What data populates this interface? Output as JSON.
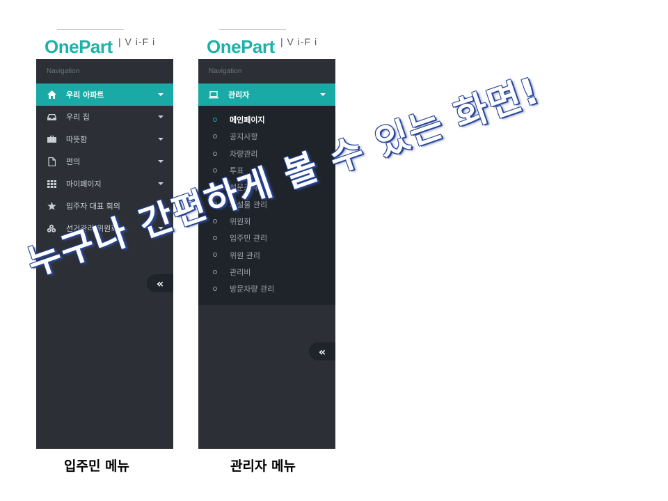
{
  "left_panel": {
    "logo": {
      "text": "OnePart",
      "sub": "| V i-F i"
    },
    "nav_header": "Navigation",
    "items": [
      {
        "label": "우리 아파트",
        "icon": "home-icon",
        "active": true
      },
      {
        "label": "우리 집",
        "icon": "inbox-icon",
        "active": false
      },
      {
        "label": "따뜻함",
        "icon": "briefcase-icon",
        "active": false
      },
      {
        "label": "편의",
        "icon": "file-icon",
        "active": false
      },
      {
        "label": "마이페이지",
        "icon": "grid-icon",
        "active": false
      },
      {
        "label": "입주자 대표 회의",
        "icon": "star-icon",
        "active": false
      },
      {
        "label": "선거관리 위원회",
        "icon": "cubes-icon",
        "active": false
      }
    ],
    "collapse_label": "«",
    "caption": "입주민 메뉴"
  },
  "right_panel": {
    "logo": {
      "text": "OnePart",
      "sub": "| V i-F i"
    },
    "nav_header": "Navigation",
    "active_item": {
      "label": "관리자",
      "icon": "laptop-icon"
    },
    "submenu": [
      {
        "label": "메인페이지",
        "active": true
      },
      {
        "label": "공지사항",
        "active": false
      },
      {
        "label": "차량관리",
        "active": false
      },
      {
        "label": "투표",
        "active": false
      },
      {
        "label": "설문조사",
        "active": false
      },
      {
        "label": "시설물 관리",
        "active": false
      },
      {
        "label": "위원회",
        "active": false
      },
      {
        "label": "입주민 관리",
        "active": false
      },
      {
        "label": "위원 관리",
        "active": false
      },
      {
        "label": "관리비",
        "active": false
      },
      {
        "label": "방문차량 관리",
        "active": false
      }
    ],
    "collapse_label": "«",
    "caption": "관리자 메뉴"
  },
  "overlay_text": "누구나 간편하게 볼 수 있는 화면!",
  "colors": {
    "accent": "#19aaa5",
    "sidebar": "#2c3036",
    "submenu_bg": "#1f242a",
    "logo": "#1bb3a9",
    "overlay_outline": "#27459a"
  }
}
